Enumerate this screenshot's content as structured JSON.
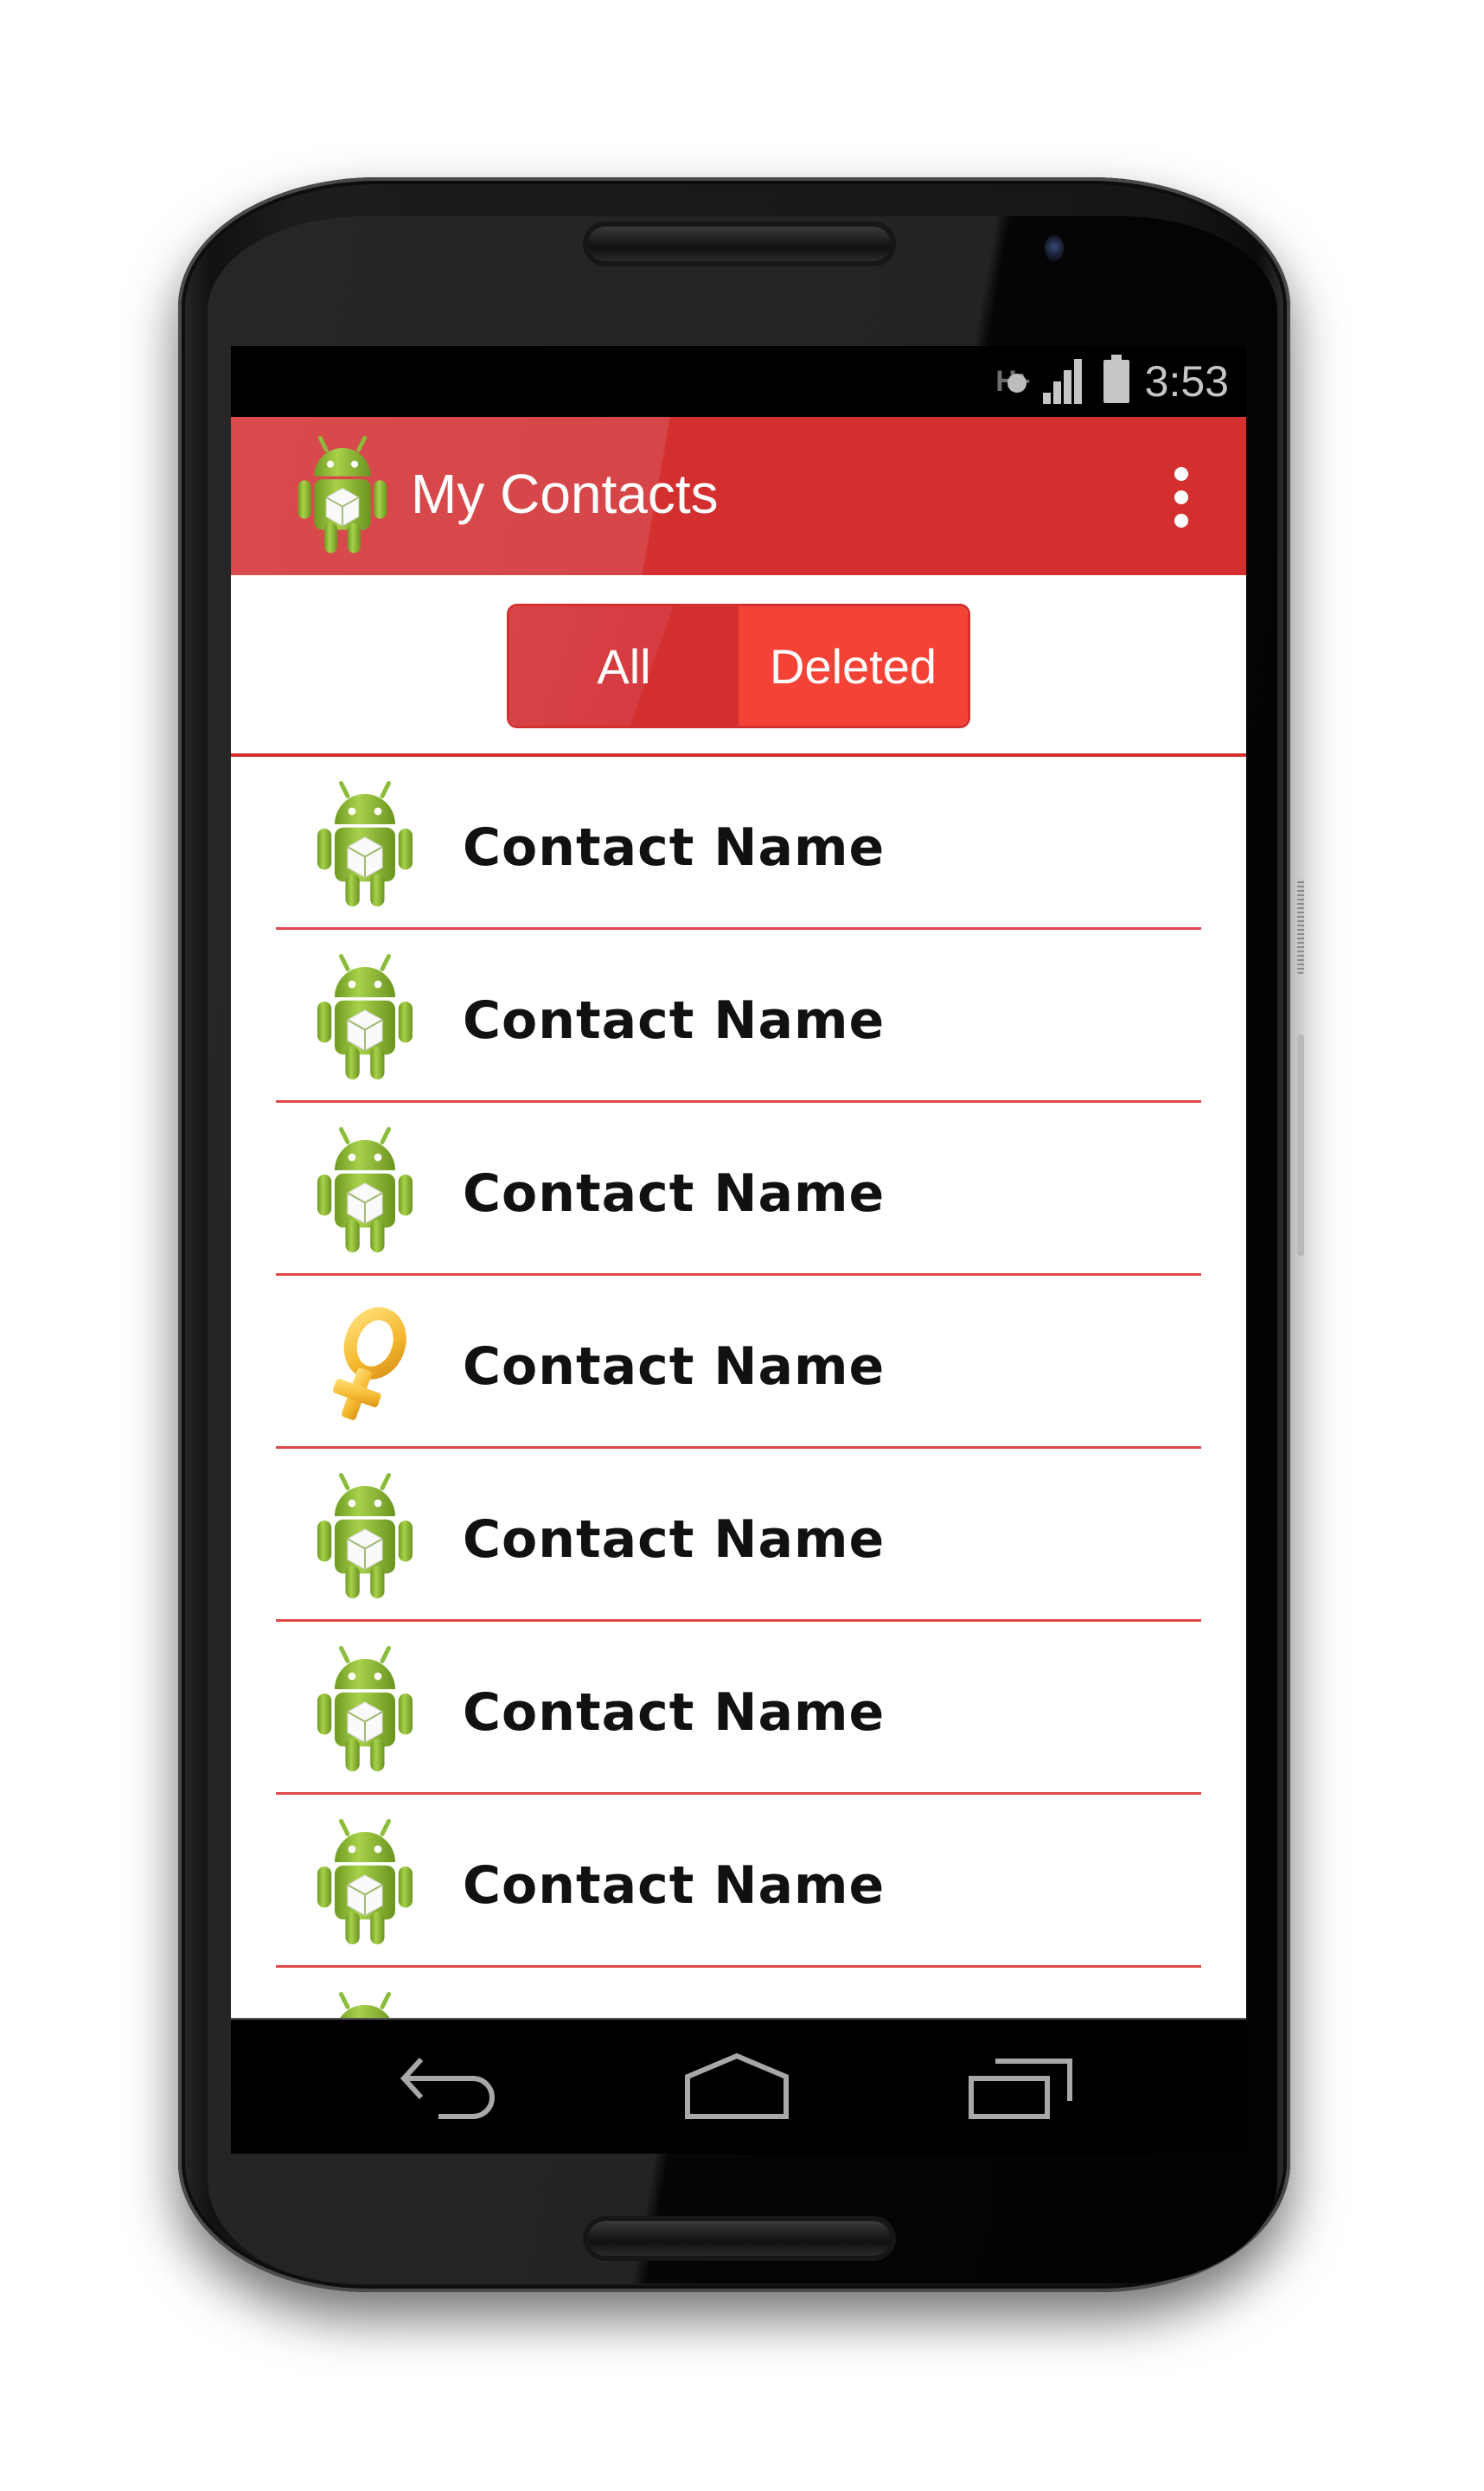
{
  "status_bar": {
    "network_type": "H+",
    "time": "3:53",
    "icons": [
      "hplus-data-icon",
      "signal-icon",
      "battery-icon"
    ]
  },
  "app_bar": {
    "title": "My Contacts",
    "logo_icon": "android-robot-icon",
    "overflow_icon": "more-vert-icon"
  },
  "filter_toggle": {
    "options": [
      {
        "label": "All",
        "selected": false
      },
      {
        "label": "Deleted",
        "selected": true
      }
    ]
  },
  "contacts": [
    {
      "name": "Contact Name",
      "avatar": "android-robot-icon"
    },
    {
      "name": "Contact Name",
      "avatar": "android-robot-icon"
    },
    {
      "name": "Contact Name",
      "avatar": "android-robot-icon"
    },
    {
      "name": "Contact Name",
      "avatar": "female-symbol-icon"
    },
    {
      "name": "Contact Name",
      "avatar": "android-robot-icon"
    },
    {
      "name": "Contact Name",
      "avatar": "android-robot-icon"
    },
    {
      "name": "Contact Name",
      "avatar": "android-robot-icon"
    },
    {
      "name": "",
      "avatar": "android-robot-icon"
    }
  ],
  "nav_bar": {
    "buttons": [
      "back-icon",
      "home-icon",
      "recents-icon"
    ]
  },
  "colors": {
    "primary": "#d32f2f",
    "accent": "#f44336",
    "android_green": "#8bbd3a",
    "divider": "#e0474b"
  }
}
